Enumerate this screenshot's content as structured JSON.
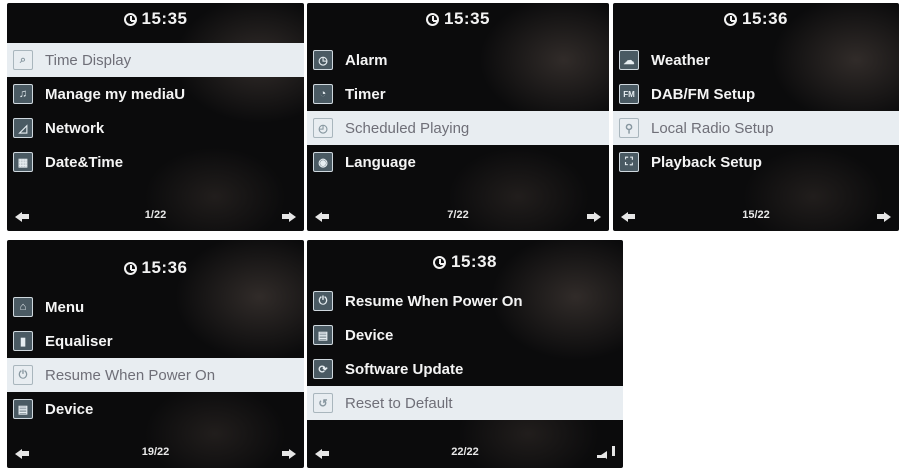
{
  "screens": [
    {
      "time": "15:35",
      "items": [
        {
          "label": "Time Display",
          "icon": "clock-search-icon",
          "selected": true
        },
        {
          "label": "Manage my mediaU",
          "icon": "media-icon",
          "selected": false
        },
        {
          "label": "Network",
          "icon": "network-icon",
          "selected": false
        },
        {
          "label": "Date&Time",
          "icon": "calendar-icon",
          "selected": false
        }
      ],
      "page": "1/22",
      "footer_right": "arrow"
    },
    {
      "time": "15:35",
      "items": [
        {
          "label": "Alarm",
          "icon": "alarm-icon",
          "selected": false
        },
        {
          "label": "Timer",
          "icon": "timer-icon",
          "selected": false
        },
        {
          "label": "Scheduled Playing",
          "icon": "schedule-icon",
          "selected": true
        },
        {
          "label": "Language",
          "icon": "language-icon",
          "selected": false
        }
      ],
      "page": "7/22",
      "footer_right": "arrow"
    },
    {
      "time": "15:36",
      "items": [
        {
          "label": "Weather",
          "icon": "weather-icon",
          "selected": false
        },
        {
          "label": "DAB/FM Setup",
          "icon": "fm-icon",
          "selected": false
        },
        {
          "label": "Local Radio Setup",
          "icon": "local-radio-icon",
          "selected": true
        },
        {
          "label": "Playback Setup",
          "icon": "playback-icon",
          "selected": false
        }
      ],
      "page": "15/22",
      "footer_right": "arrow"
    },
    {
      "time": "15:36",
      "items": [
        {
          "label": "Menu",
          "icon": "home-icon",
          "selected": false
        },
        {
          "label": "Equaliser",
          "icon": "equaliser-icon",
          "selected": false
        },
        {
          "label": "Resume When Power On",
          "icon": "power-icon",
          "selected": true
        },
        {
          "label": "Device",
          "icon": "device-icon",
          "selected": false
        }
      ],
      "page": "19/22",
      "footer_right": "arrow"
    },
    {
      "time": "15:38",
      "items": [
        {
          "label": "Resume When Power On",
          "icon": "power-icon",
          "selected": false
        },
        {
          "label": "Device",
          "icon": "device-icon",
          "selected": false
        },
        {
          "label": "Software Update",
          "icon": "update-icon",
          "selected": false
        },
        {
          "label": "Reset to Default",
          "icon": "reset-icon",
          "selected": true
        }
      ],
      "page": "22/22",
      "footer_right": "enter"
    }
  ],
  "colors": {
    "screen_bg": "#0b0b0c",
    "selected_row_bg": "#e8edf1",
    "text": "#f4f4f4",
    "selected_text": "#6f6f78"
  }
}
